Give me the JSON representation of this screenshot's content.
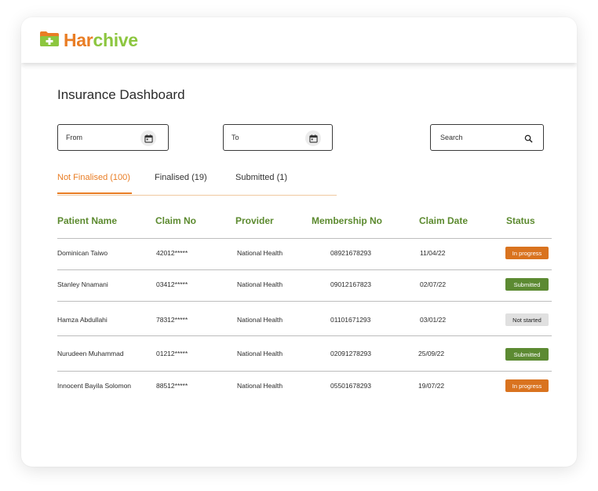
{
  "brand": {
    "part1": "Har",
    "part2": "chive",
    "icon": "folder-plus-icon"
  },
  "page": {
    "title": "Insurance Dashboard"
  },
  "filters": {
    "from_label": "From",
    "to_label": "To",
    "search_label": "Search",
    "calendar_icon": "calendar-icon",
    "search_icon": "search-icon"
  },
  "tabs": [
    {
      "label": "Not Finalised (100)",
      "active": true
    },
    {
      "label": "Finalised (19)",
      "active": false
    },
    {
      "label": "Submitted (1)",
      "active": false
    }
  ],
  "table": {
    "columns": [
      "Patient Name",
      "Claim No",
      "Provider",
      "Membership No",
      "Claim Date",
      "Status"
    ],
    "rows": [
      {
        "patient": "Dominican Taiwo",
        "claim_no": "42012*****",
        "provider": "National Health",
        "membership_no": "08921678293",
        "date": "11/04/22",
        "status": "In progress"
      },
      {
        "patient": "Stanley Nnamani",
        "claim_no": "03412*****",
        "provider": "National Health",
        "membership_no": "09012167823",
        "date": "02/07/22",
        "status": "Submitted"
      },
      {
        "patient": "Hamza Abdullahi",
        "claim_no": "78312*****",
        "provider": "National Health",
        "membership_no": "01101671293",
        "date": "03/01/22",
        "status": "Not started"
      },
      {
        "patient": "Nurudeen Muhammad",
        "claim_no": "01212*****",
        "provider": "National Health",
        "membership_no": "02091278293",
        "date": "25/09/22",
        "status": "Submitted"
      },
      {
        "patient": "Innocent Bayila Solomon",
        "claim_no": "88512*****",
        "provider": "National Health",
        "membership_no": "05501678293",
        "date": "19/07/22",
        "status": "In progress"
      }
    ]
  },
  "status_colors": {
    "In progress": "#d9731f",
    "Submitted": "#5c8a32",
    "Not started": "#e0e0e0"
  },
  "colors": {
    "accent_orange": "#e97d24",
    "accent_green": "#5c8a2f",
    "logo_green": "#8cc63f"
  }
}
